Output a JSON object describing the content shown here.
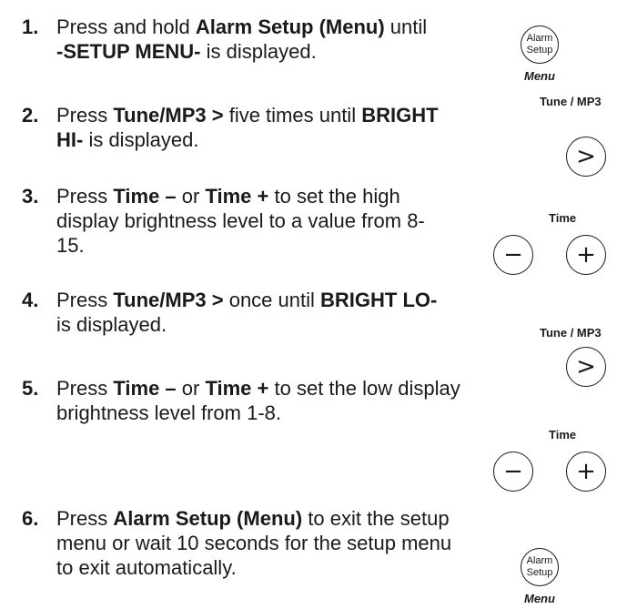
{
  "steps": [
    {
      "num": "1.",
      "parts": [
        {
          "t": "Press and hold ",
          "b": false
        },
        {
          "t": "Alarm Setup (Menu)",
          "b": true
        },
        {
          "t": " until ",
          "b": false
        },
        {
          "t": "-SETUP MENU-",
          "b": true
        },
        {
          "t": " is displayed.",
          "b": false
        }
      ]
    },
    {
      "num": "2.",
      "parts": [
        {
          "t": "Press ",
          "b": false
        },
        {
          "t": "Tune/MP3 >",
          "b": true
        },
        {
          "t": " five times until ",
          "b": false
        },
        {
          "t": "BRIGHT HI-",
          "b": true
        },
        {
          "t": " is displayed.",
          "b": false
        }
      ]
    },
    {
      "num": "3.",
      "parts": [
        {
          "t": "Press ",
          "b": false
        },
        {
          "t": "Time –",
          "b": true
        },
        {
          "t": " or ",
          "b": false
        },
        {
          "t": "Time +",
          "b": true
        },
        {
          "t": " to set the high display brightness level to a value from 8-15.",
          "b": false
        }
      ]
    },
    {
      "num": "4.",
      "parts": [
        {
          "t": "Press ",
          "b": false
        },
        {
          "t": "Tune/MP3 >",
          "b": true
        },
        {
          "t": " once until ",
          "b": false
        },
        {
          "t": "BRIGHT LO-",
          "b": true
        },
        {
          "t": " is displayed.",
          "b": false
        }
      ]
    },
    {
      "num": "5.",
      "parts": [
        {
          "t": "Press ",
          "b": false
        },
        {
          "t": "Time –",
          "b": true
        },
        {
          "t": " or ",
          "b": false
        },
        {
          "t": "Time +",
          "b": true
        },
        {
          "t": " to set the low display brightness level from 1-8.",
          "b": false
        }
      ]
    },
    {
      "num": "6.",
      "parts": [
        {
          "t": "Press ",
          "b": false
        },
        {
          "t": "Alarm Setup (Menu)",
          "b": true
        },
        {
          "t": " to exit the setup menu or wait 10 seconds for the setup menu to exit automatically.",
          "b": false
        }
      ]
    }
  ],
  "icons": {
    "alarm_line1": "Alarm",
    "alarm_line2": "Setup",
    "menu_label": "Menu",
    "tune_label": "Tune / MP3",
    "tune_symbol": ">",
    "time_label": "Time",
    "minus_symbol": "−",
    "plus_symbol": "+"
  }
}
